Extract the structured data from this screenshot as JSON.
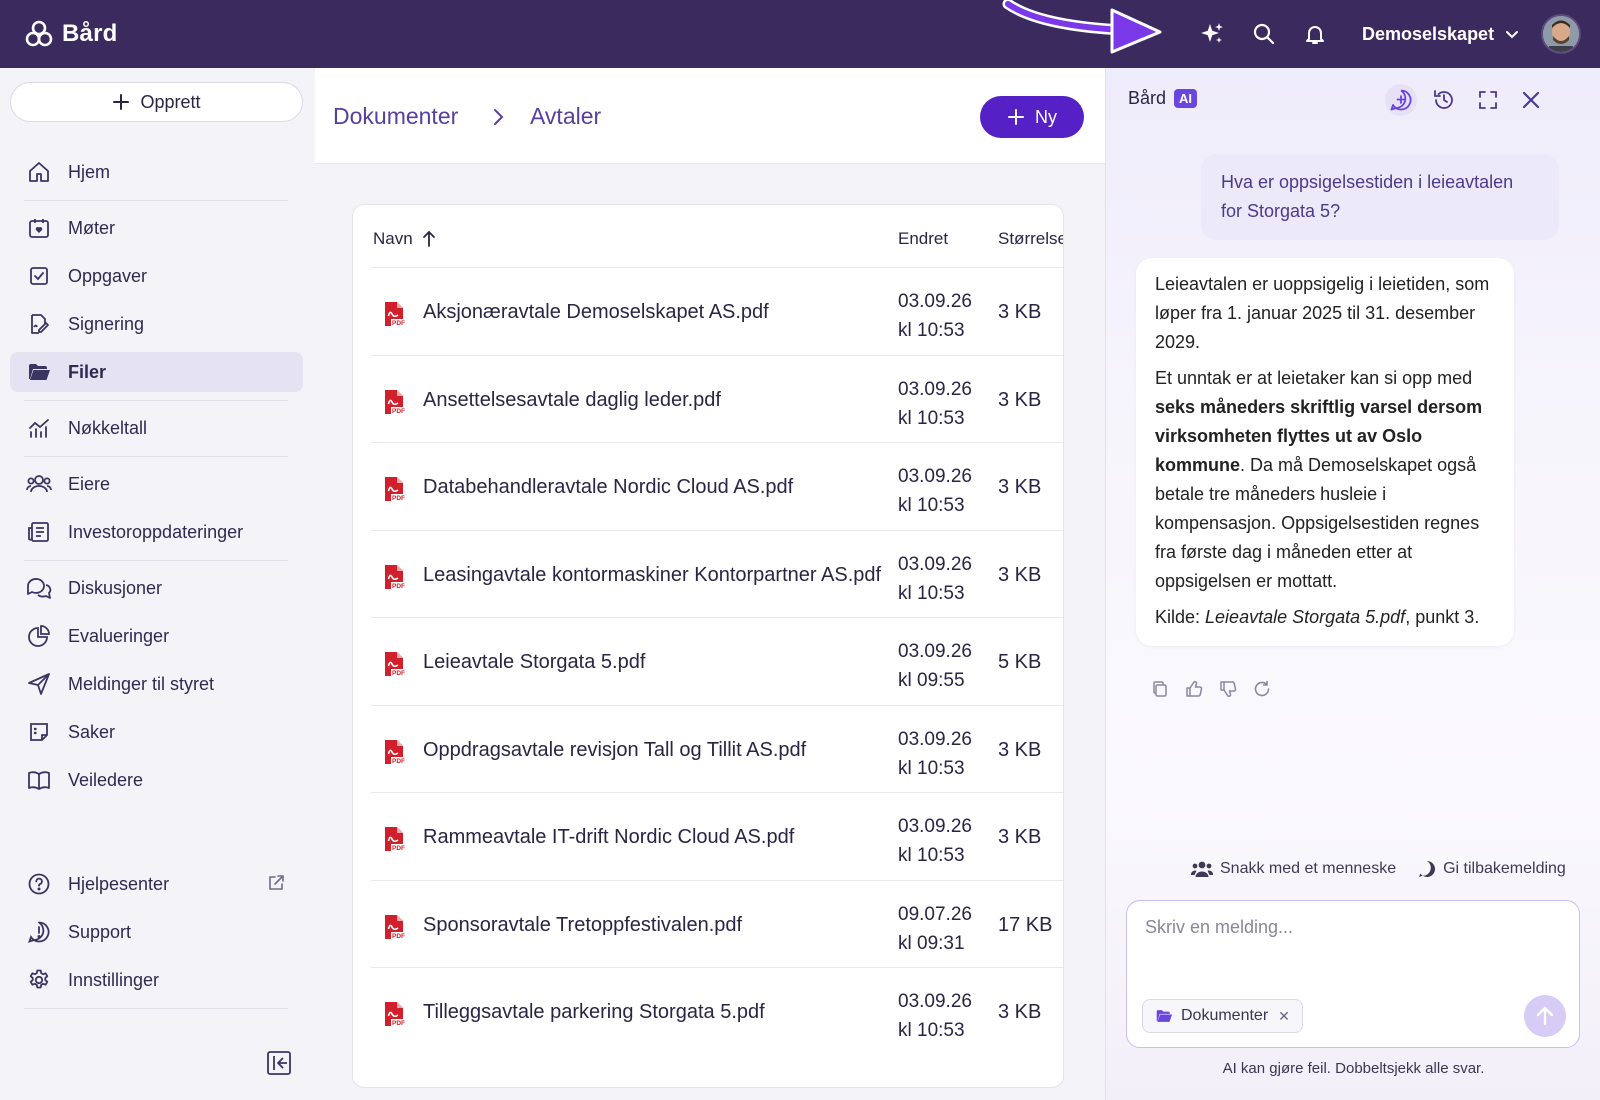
{
  "colors": {
    "topbar": "#3b2a5e",
    "accent": "#5521c7",
    "ai_badge": "#6a45e0",
    "pdf_red": "#d11f2b"
  },
  "brand": {
    "name": "Bård",
    "icon": "brand-logo-icon"
  },
  "topbar": {
    "icons": [
      "sparkle-icon",
      "search-icon",
      "bell-icon",
      "chevron-down-icon"
    ],
    "company": "Demoselskapet"
  },
  "sidebar": {
    "create_label": "Opprett",
    "items": [
      {
        "label": "Hjem",
        "icon": "home-icon"
      },
      {
        "label": "Møter",
        "icon": "calendar-icon"
      },
      {
        "label": "Oppgaver",
        "icon": "checkbox-icon"
      },
      {
        "label": "Signering",
        "icon": "signature-icon"
      },
      {
        "label": "Filer",
        "icon": "folder-icon",
        "active": true
      },
      {
        "label": "Nøkkeltall",
        "icon": "chart-icon"
      },
      {
        "label": "Eiere",
        "icon": "users-icon"
      },
      {
        "label": "Investoroppdateringer",
        "icon": "newspaper-icon"
      },
      {
        "label": "Diskusjoner",
        "icon": "chat-icon"
      },
      {
        "label": "Evalueringer",
        "icon": "pie-chart-icon"
      },
      {
        "label": "Meldinger til styret",
        "icon": "send-icon"
      },
      {
        "label": "Saker",
        "icon": "list-icon"
      },
      {
        "label": "Veiledere",
        "icon": "book-icon"
      }
    ],
    "bottom_items": [
      {
        "label": "Hjelpesenter",
        "icon": "help-icon",
        "external": true
      },
      {
        "label": "Support",
        "icon": "support-icon"
      },
      {
        "label": "Innstillinger",
        "icon": "gear-icon"
      }
    ]
  },
  "main": {
    "breadcrumb": [
      "Dokumenter",
      "Avtaler"
    ],
    "new_button_label": "Ny",
    "columns": {
      "name": "Navn",
      "modified": "Endret",
      "size": "Størrelse"
    },
    "files": [
      {
        "name": "Aksjonæravtale Demoselskapet AS.pdf",
        "date": "03.09.26",
        "time": "kl 10:53",
        "size": "3 KB"
      },
      {
        "name": "Ansettelsesavtale daglig leder.pdf",
        "date": "03.09.26",
        "time": "kl 10:53",
        "size": "3 KB"
      },
      {
        "name": "Databehandleravtale Nordic Cloud AS.pdf",
        "date": "03.09.26",
        "time": "kl 10:53",
        "size": "3 KB"
      },
      {
        "name": "Leasingavtale kontormaskiner Kontorpartner AS.pdf",
        "date": "03.09.26",
        "time": "kl 10:53",
        "size": "3 KB"
      },
      {
        "name": "Leieavtale Storgata 5.pdf",
        "date": "03.09.26",
        "time": "kl 09:55",
        "size": "5 KB"
      },
      {
        "name": "Oppdragsavtale revisjon Tall og Tillit AS.pdf",
        "date": "03.09.26",
        "time": "kl 10:53",
        "size": "3 KB"
      },
      {
        "name": "Rammeavtale IT-drift Nordic Cloud AS.pdf",
        "date": "03.09.26",
        "time": "kl 10:53",
        "size": "3 KB"
      },
      {
        "name": "Sponsoravtale Tretoppfestivalen.pdf",
        "date": "09.07.26",
        "time": "kl 09:31",
        "size": "17 KB"
      },
      {
        "name": "Tilleggsavtale parkering Storgata 5.pdf",
        "date": "03.09.26",
        "time": "kl 10:53",
        "size": "3 KB"
      }
    ]
  },
  "ai": {
    "title": "Bård",
    "badge": "AI",
    "tools": [
      "new-chat-icon",
      "history-icon",
      "expand-icon",
      "close-icon"
    ],
    "user_message": "Hva er oppsigelsestiden i leieavtalen for Storgata 5?",
    "answer": {
      "p1": "Leieavtalen er uoppsigelig i leietiden, som løper fra 1. januar 2025 til 31. desember 2029.",
      "p2_start": "Et unntak er at leietaker kan si opp med ",
      "p2_bold": "seks måneders skriftlig varsel dersom virksomheten flyttes ut av Oslo kommune",
      "p2_end": ". Da må Demoselskapet også betale tre måneders husleie i kompensasjon. Oppsigelsestiden regnes fra første dag i måneden etter at oppsigelsen er mottatt.",
      "source_label": "Kilde: ",
      "source_doc": "Leieavtale Storgata 5.pdf",
      "source_end": ", punkt 3."
    },
    "message_actions": [
      "copy-icon",
      "thumbs-up-icon",
      "thumbs-down-icon",
      "regenerate-icon"
    ],
    "talk_to_human": "Snakk med et menneske",
    "feedback": "Gi tilbakemelding",
    "input_placeholder": "Skriv en melding...",
    "context_chip": "Dokumenter",
    "disclaimer": "AI kan gjøre feil. Dobbeltsjekk alle svar."
  }
}
